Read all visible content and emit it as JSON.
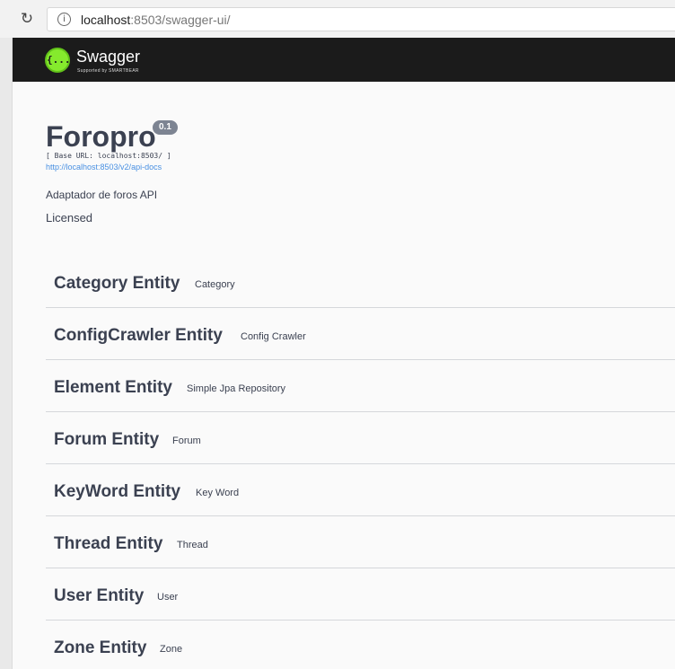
{
  "browser": {
    "url_host": "localhost",
    "url_rest": ":8503/swagger-ui/"
  },
  "header": {
    "logo_text": "{...}",
    "brand": "Swagger",
    "tagline": "Supported by SMARTBEAR"
  },
  "info": {
    "title": "Foropro",
    "version": "0.1",
    "base_url": "[ Base URL: localhost:8503/ ]",
    "docs_link": "http://localhost:8503/v2/api-docs",
    "description": "Adaptador de foros API",
    "license": "Licensed"
  },
  "tags": [
    {
      "name": "Category Entity",
      "description": "Category"
    },
    {
      "name": "ConfigCrawler Entity",
      "description": "Config Crawler"
    },
    {
      "name": "Element Entity",
      "description": "Simple Jpa Repository"
    },
    {
      "name": "Forum Entity",
      "description": "Forum"
    },
    {
      "name": "KeyWord Entity",
      "description": "Key Word"
    },
    {
      "name": "Thread Entity",
      "description": "Thread"
    },
    {
      "name": "User Entity",
      "description": "User"
    },
    {
      "name": "Zone Entity",
      "description": "Zone"
    }
  ],
  "colors": {
    "topbar": "#1b1b1b",
    "logo_green": "#85ea2d",
    "text": "#3b4151",
    "link": "#4990e2",
    "version_badge": "#7d8492"
  }
}
